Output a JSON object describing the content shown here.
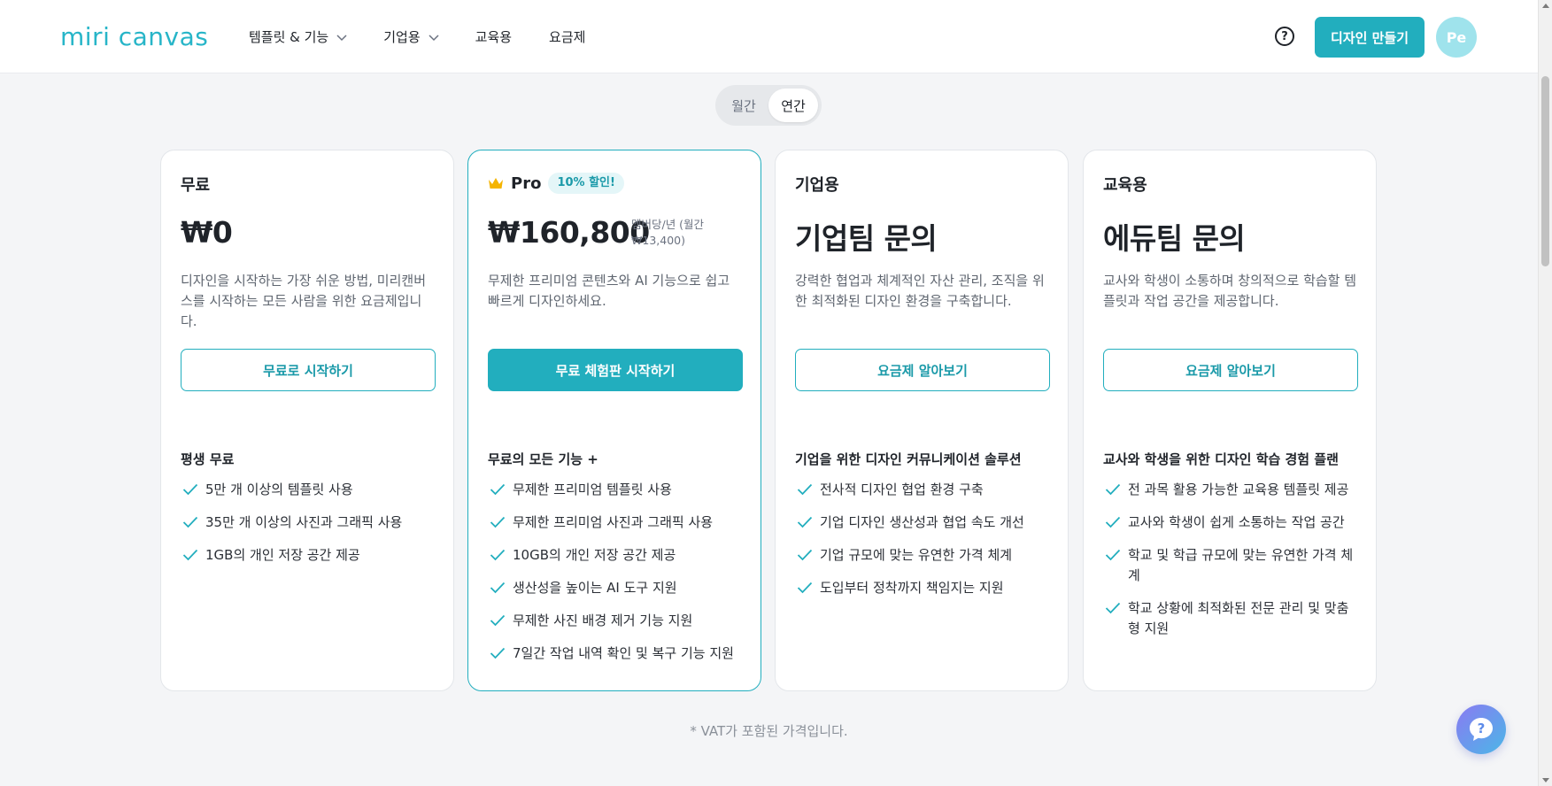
{
  "header": {
    "logo_text": "miri canvas",
    "nav": [
      {
        "label": "템플릿 & 기능",
        "has_dropdown": true
      },
      {
        "label": "기업용",
        "has_dropdown": true
      },
      {
        "label": "교육용",
        "has_dropdown": false
      },
      {
        "label": "요금제",
        "has_dropdown": false
      }
    ],
    "help_icon": "question-circle-icon",
    "help_glyph": "?",
    "create_label": "디자인 만들기",
    "avatar_initials": "Pe"
  },
  "billing_toggle": {
    "options": [
      "월간",
      "연간"
    ],
    "selected": "연간"
  },
  "plans": [
    {
      "name": "무료",
      "price": "₩0",
      "desc": "디자인을 시작하는 가장 쉬운 방법, 미리캔버스를 시작하는 모든 사람을 위한 요금제입니다.",
      "cta": "무료로 시작하기",
      "feature_title": "평생 무료",
      "features": [
        "5만 개 이상의 템플릿 사용",
        "35만 개 이상의 사진과 그래픽 사용",
        "1GB의 개인 저장 공간 제공"
      ]
    },
    {
      "name": "Pro",
      "badge": "10% 할인!",
      "price": "₩160,800",
      "price_note": "멤버당/년 (월간 ₩13,400)",
      "desc": "무제한 프리미엄 콘텐츠와 AI 기능으로 쉽고 빠르게 디자인하세요.",
      "cta": "무료 체험판 시작하기",
      "feature_title": "무료의 모든 기능 +",
      "features": [
        "무제한 프리미엄 템플릿 사용",
        "무제한 프리미엄 사진과 그래픽 사용",
        "10GB의 개인 저장 공간 제공",
        "생산성을 높이는 AI 도구 지원",
        "무제한 사진 배경 제거 기능 지원",
        "7일간 작업 내역 확인 및 복구 기능 지원"
      ]
    },
    {
      "name": "기업용",
      "price": "기업팀 문의",
      "desc": "강력한 협업과 체계적인 자산 관리, 조직을 위한 최적화된 디자인 환경을 구축합니다.",
      "cta": "요금제 알아보기",
      "feature_title": "기업을 위한 디자인 커뮤니케이션 솔루션",
      "features": [
        "전사적 디자인 협업 환경 구축",
        "기업 디자인 생산성과 협업 속도 개선",
        "기업 규모에 맞는 유연한 가격 체계",
        "도입부터 정착까지 책임지는 지원"
      ]
    },
    {
      "name": "교육용",
      "price": "에듀팀 문의",
      "desc": "교사와 학생이 소통하며 창의적으로 학습할 템플릿과 작업 공간을 제공합니다.",
      "cta": "요금제 알아보기",
      "feature_title": "교사와 학생을 위한 디자인 학습 경험 플랜",
      "features": [
        "전 과목 활용 가능한 교육용 템플릿 제공",
        "교사와 학생이 쉽게 소통하는 작업 공간",
        "학교 및 학급 규모에 맞는 유연한 가격 체계",
        "학교 상황에 최적화된 전문 관리 및 맞춤형 지원"
      ]
    }
  ],
  "vat_note": "* VAT가 포함된 가격입니다.",
  "chat_glyph": "?",
  "colors": {
    "accent": "#22aebe",
    "accent_text": "#1b9aa9",
    "background": "#f4f5f7",
    "crown": "#f5b400"
  }
}
